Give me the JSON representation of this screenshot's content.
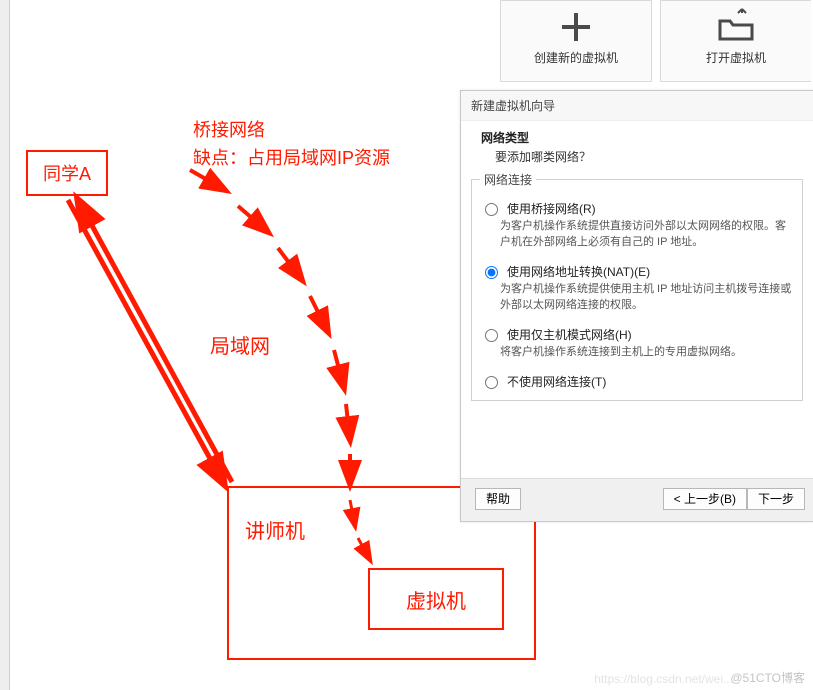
{
  "tiles": {
    "create": "创建新的虚拟机",
    "open": "打开虚拟机"
  },
  "annot": {
    "studentA": "同学A",
    "bridge_line1": "桥接网络",
    "bridge_line2": "缺点：占用局域网IP资源",
    "lan": "局域网",
    "teacher": "讲师机",
    "vm": "虚拟机"
  },
  "dialog": {
    "title": "新建虚拟机向导",
    "heading": "网络类型",
    "subheading": "要添加哪类网络？",
    "group": "网络连接",
    "opts": {
      "bridge": {
        "label": "使用桥接网络(R)",
        "desc": "为客户机操作系统提供直接访问外部以太网网络的权限。客户机在外部网络上必须有自己的 IP 地址。"
      },
      "nat": {
        "label": "使用网络地址转换(NAT)(E)",
        "desc": "为客户机操作系统提供使用主机 IP 地址访问主机拨号连接或外部以太网网络连接的权限。"
      },
      "host": {
        "label": "使用仅主机模式网络(H)",
        "desc": "将客户机操作系统连接到主机上的专用虚拟网络。"
      },
      "none": {
        "label": "不使用网络连接(T)"
      }
    },
    "buttons": {
      "help": "帮助",
      "prev": "< 上一步(B)",
      "next": "下一步"
    }
  },
  "watermark": {
    "a": "https://blog.csdn.net/wei...",
    "b": "@51CTO博客"
  }
}
